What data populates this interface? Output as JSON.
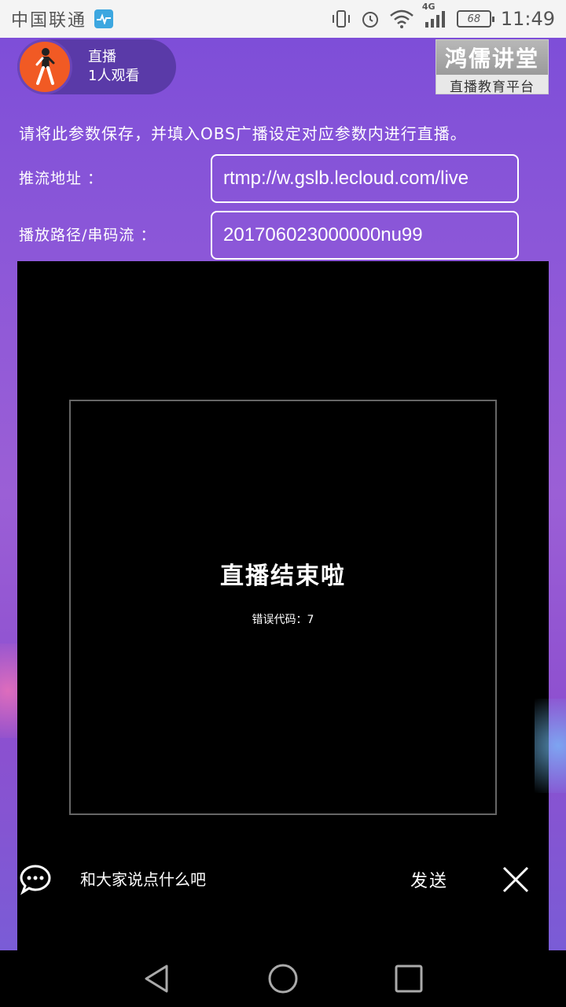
{
  "status_bar": {
    "carrier": "中国联通",
    "network": "4G",
    "battery": "68",
    "time": "11:49"
  },
  "host": {
    "status": "直播",
    "viewers": "1人观看"
  },
  "brand": {
    "name": "鸿儒讲堂",
    "tagline": "直播教育平台"
  },
  "instructions": "请将此参数保存，并填入OBS广播设定对应参数内进行直播。",
  "stream_fields": [
    {
      "label": "推流地址 ：",
      "value": "rtmp://w.gslb.lecloud.com/live"
    },
    {
      "label": "播放路径/串码流 ：",
      "value": "201706023000000nu99"
    }
  ],
  "player": {
    "end_message": "直播结束啦",
    "error_text": "错误代码：7"
  },
  "chat": {
    "placeholder": "和大家说点什么吧",
    "send_label": "发送"
  },
  "colors": {
    "accent": "#8a56d8",
    "avatar": "#f15a24"
  }
}
